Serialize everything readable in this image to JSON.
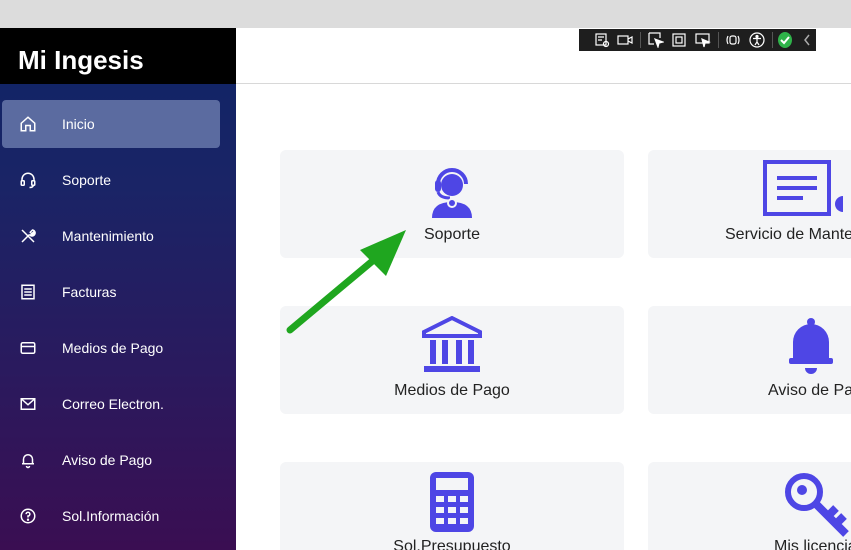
{
  "brand": {
    "title": "Mi Ingesis"
  },
  "sidebar": {
    "items": [
      {
        "label": "Inicio",
        "icon": "home-icon",
        "active": true
      },
      {
        "label": "Soporte",
        "icon": "headset-icon"
      },
      {
        "label": "Mantenimiento",
        "icon": "tools-icon"
      },
      {
        "label": "Facturas",
        "icon": "invoice-icon"
      },
      {
        "label": "Medios de Pago",
        "icon": "credit-card-icon"
      },
      {
        "label": "Correo Electron.",
        "icon": "mail-icon"
      },
      {
        "label": "Aviso de Pago",
        "icon": "bell-icon"
      },
      {
        "label": "Sol.Información",
        "icon": "help-circle-icon"
      }
    ]
  },
  "toolbar": {
    "icons": [
      "inspect-icon",
      "video-icon",
      "select-element-icon",
      "frame-icon",
      "hover-icon",
      "screen-reader-icon",
      "accessibility-icon",
      "check-icon",
      "chevron-left-icon"
    ]
  },
  "cards": [
    {
      "label": "Soporte",
      "icon": "headset-support-icon"
    },
    {
      "label": "Servicio de Mante",
      "icon": "service-document-icon"
    },
    {
      "label": "Medios de Pago",
      "icon": "bank-icon"
    },
    {
      "label": "Aviso de Pa",
      "icon": "bell-icon"
    },
    {
      "label": "Sol.Presupuesto",
      "icon": "calculator-icon"
    },
    {
      "label": "Mis licencia",
      "icon": "key-icon"
    }
  ],
  "colors": {
    "accent": "#4e46e5",
    "sidebar_active": "#5b6ba0",
    "arrow": "#1fa61f"
  }
}
